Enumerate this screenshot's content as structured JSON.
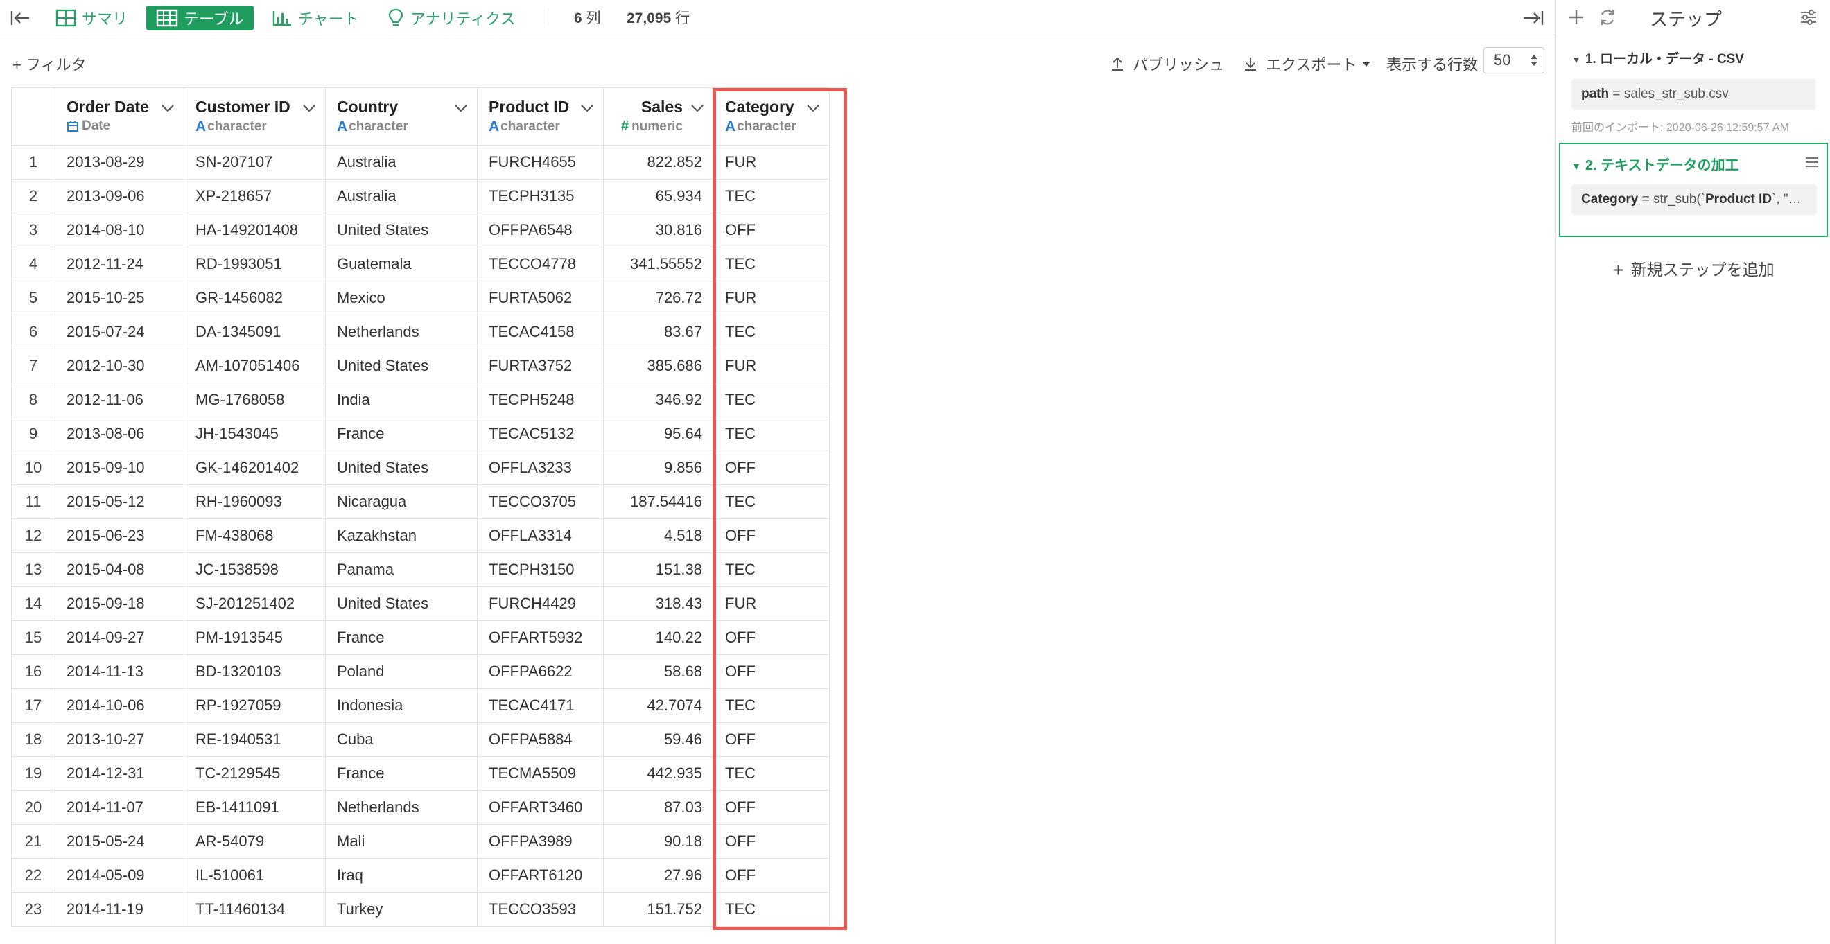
{
  "toolbar": {
    "summary": "サマリ",
    "table": "テーブル",
    "chart": "チャート",
    "analytics": "アナリティクス",
    "col_count": "6",
    "col_unit": "列",
    "row_count": "27,095",
    "row_unit": "行"
  },
  "filterbar": {
    "filter": "+ フィルタ",
    "publish": "パブリッシュ",
    "export": "エクスポート",
    "rows_label": "表示する行数",
    "rows_value": "50"
  },
  "columns": [
    {
      "name": "Order Date",
      "type": "Date",
      "type_icon": "calendar-icon"
    },
    {
      "name": "Customer ID",
      "type": "character",
      "type_icon": "character-icon"
    },
    {
      "name": "Country",
      "type": "character",
      "type_icon": "character-icon"
    },
    {
      "name": "Product ID",
      "type": "character",
      "type_icon": "character-icon"
    },
    {
      "name": "Sales",
      "type": "numeric",
      "type_icon": "numeric-icon"
    },
    {
      "name": "Category",
      "type": "character",
      "type_icon": "character-icon"
    }
  ],
  "rows": [
    [
      "1",
      "2013-08-29",
      "SN-207107",
      "Australia",
      "FURCH4655",
      "822.852",
      "FUR"
    ],
    [
      "2",
      "2013-09-06",
      "XP-218657",
      "Australia",
      "TECPH3135",
      "65.934",
      "TEC"
    ],
    [
      "3",
      "2014-08-10",
      "HA-149201408",
      "United States",
      "OFFPA6548",
      "30.816",
      "OFF"
    ],
    [
      "4",
      "2012-11-24",
      "RD-1993051",
      "Guatemala",
      "TECCO4778",
      "341.55552",
      "TEC"
    ],
    [
      "5",
      "2015-10-25",
      "GR-1456082",
      "Mexico",
      "FURTA5062",
      "726.72",
      "FUR"
    ],
    [
      "6",
      "2015-07-24",
      "DA-1345091",
      "Netherlands",
      "TECAC4158",
      "83.67",
      "TEC"
    ],
    [
      "7",
      "2012-10-30",
      "AM-107051406",
      "United States",
      "FURTA3752",
      "385.686",
      "FUR"
    ],
    [
      "8",
      "2012-11-06",
      "MG-1768058",
      "India",
      "TECPH5248",
      "346.92",
      "TEC"
    ],
    [
      "9",
      "2013-08-06",
      "JH-1543045",
      "France",
      "TECAC5132",
      "95.64",
      "TEC"
    ],
    [
      "10",
      "2015-09-10",
      "GK-146201402",
      "United States",
      "OFFLA3233",
      "9.856",
      "OFF"
    ],
    [
      "11",
      "2015-05-12",
      "RH-1960093",
      "Nicaragua",
      "TECCO3705",
      "187.54416",
      "TEC"
    ],
    [
      "12",
      "2015-06-23",
      "FM-438068",
      "Kazakhstan",
      "OFFLA3314",
      "4.518",
      "OFF"
    ],
    [
      "13",
      "2015-04-08",
      "JC-1538598",
      "Panama",
      "TECPH3150",
      "151.38",
      "TEC"
    ],
    [
      "14",
      "2015-09-18",
      "SJ-201251402",
      "United States",
      "FURCH4429",
      "318.43",
      "FUR"
    ],
    [
      "15",
      "2014-09-27",
      "PM-1913545",
      "France",
      "OFFART5932",
      "140.22",
      "OFF"
    ],
    [
      "16",
      "2014-11-13",
      "BD-1320103",
      "Poland",
      "OFFPA6622",
      "58.68",
      "OFF"
    ],
    [
      "17",
      "2014-10-06",
      "RP-1927059",
      "Indonesia",
      "TECAC4171",
      "42.7074",
      "TEC"
    ],
    [
      "18",
      "2013-10-27",
      "RE-1940531",
      "Cuba",
      "OFFPA5884",
      "59.46",
      "OFF"
    ],
    [
      "19",
      "2014-12-31",
      "TC-2129545",
      "France",
      "TECMA5509",
      "442.935",
      "TEC"
    ],
    [
      "20",
      "2014-11-07",
      "EB-1411091",
      "Netherlands",
      "OFFART3460",
      "87.03",
      "OFF"
    ],
    [
      "21",
      "2015-05-24",
      "AR-54079",
      "Mali",
      "OFFPA3989",
      "90.18",
      "OFF"
    ],
    [
      "22",
      "2014-05-09",
      "IL-510061",
      "Iraq",
      "OFFART6120",
      "27.96",
      "OFF"
    ],
    [
      "23",
      "2014-11-19",
      "TT-11460134",
      "Turkey",
      "TECCO3593",
      "151.752",
      "TEC"
    ]
  ],
  "sidebar": {
    "title": "ステップ",
    "step1_title": "1. ローカル・データ - CSV",
    "step1_key": "path",
    "step1_val": " = sales_str_sub.csv",
    "step1_import": "前回のインポート: 2020-06-26 12:59:57 AM",
    "step2_title": "2. テキストデータの加工",
    "step2_key": "Category",
    "step2_mid": " = str_sub(`",
    "step2_bold": "Product ID",
    "step2_tail": "`, \"…",
    "add_step": "新規ステップを追加"
  },
  "colors": {
    "accent": "#1f9d5f",
    "highlight": "#e25b55",
    "char_type": "#2b7bd3",
    "num_type": "#28a869"
  }
}
